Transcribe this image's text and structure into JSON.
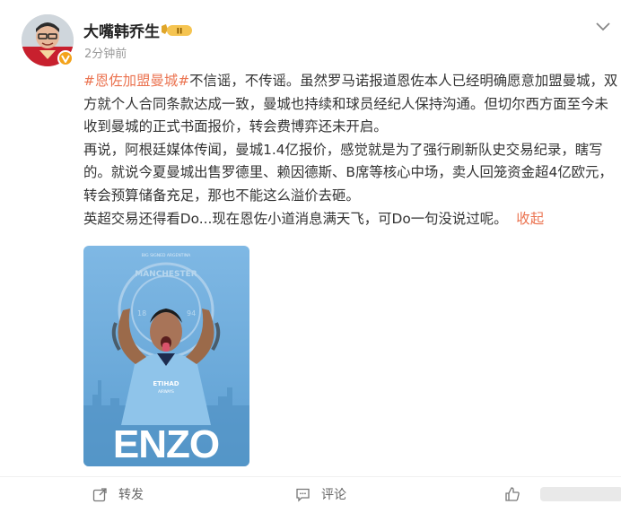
{
  "post": {
    "author": "大嘴韩乔生",
    "time": "2分钟前",
    "level_badge": "II",
    "topic": "#恩佐加盟曼城#",
    "paragraph1": "不信谣，不传谣。虽然罗马诺报道恩佐本人已经明确愿意加盟曼城，双方就个人合同条款达成一致，曼城也持续和球员经纪人保持沟通。但切尔西方面至今未收到曼城的正式书面报价，转会费博弈还未开启。",
    "paragraph2": "再说，阿根廷媒体传闻，曼城1.4亿报价，感觉就是为了强行刷新队史交易纪录，瞎写的。就说今夏曼城出售罗德里、赖因德斯、B席等核心中场，卖人回笼资金超4亿欧元，转会预算储备充足，那也不能这么溢价去砸。",
    "paragraph3": "英超交易还得看Do...现在恩佐小道消息满天飞，可Do一句没说过呢。",
    "collapse_label": "收起"
  },
  "image": {
    "top_text": "BIG SIGNED ARGENTINA",
    "crest_text": "MANCHESTER",
    "crest_left": "18",
    "crest_right": "94",
    "shirt_brand": "ETIHAD",
    "shirt_brand2": "AIRWAYS",
    "player_name": "ENZO"
  },
  "actions": {
    "share_label": "转发",
    "comment_label": "评论"
  },
  "colors": {
    "accent": "#eb7350",
    "sky": "#6cabdd",
    "badge": "#f3a21a"
  },
  "icons": [
    "avatar",
    "verified-icon",
    "level-badge-icon",
    "more-icon",
    "share-icon",
    "comment-icon",
    "like-icon"
  ]
}
